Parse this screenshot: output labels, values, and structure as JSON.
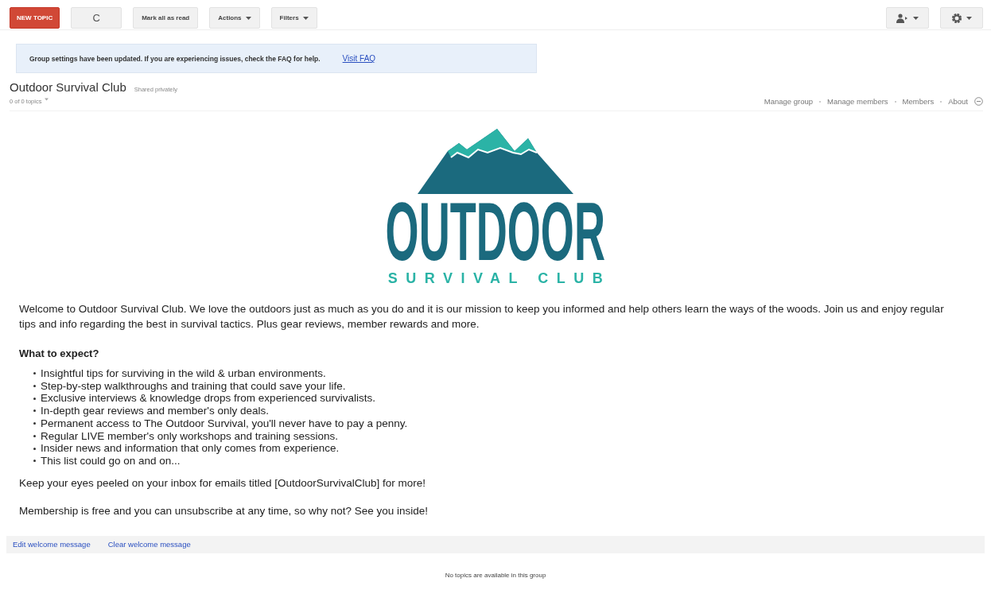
{
  "toolbar": {
    "new_topic": "NEW TOPIC",
    "refresh": "C",
    "mark_all_read": "Mark all as read",
    "actions": "Actions",
    "filters": "Filters"
  },
  "notice": {
    "text": "Group settings have been updated. If you are experiencing issues, check the FAQ for help.",
    "link": "Visit FAQ"
  },
  "group": {
    "title": "Outdoor Survival Club",
    "sharing": "Shared privately",
    "topic_count": "0 of 0 topics",
    "links": [
      "Manage group",
      "Manage members",
      "Members",
      "About"
    ]
  },
  "logo": {
    "word": "OUTDOOR",
    "tagline": "SURVIVAL CLUB"
  },
  "welcome": {
    "intro": "Welcome to Outdoor Survival Club. We love the outdoors just as much as you do and it is our mission to keep you informed and help others learn the ways of the woods. Join us and enjoy regular tips and info regarding the best in survival tactics. Plus gear reviews, member rewards and more.",
    "heading": "What to expect?",
    "items": [
      "Insightful tips for surviving in the wild & urban environments.",
      "Step-by-step walkthroughs and training that could save your life.",
      "Exclusive interviews & knowledge drops from experienced survivalists.",
      "In-depth gear reviews and member's only deals.",
      "Permanent access to The Outdoor Survival, you'll never have to pay a penny.",
      "Regular LIVE member's only workshops and training sessions.",
      "Insider news and information that only comes from experience.",
      "This list could go on and on..."
    ],
    "paragraphs": [
      "Keep your eyes peeled on your inbox for emails titled [OutdoorSurvivalClub] for more!",
      "Membership is free and you can unsubscribe at any time, so why not? See you inside!"
    ]
  },
  "welcome_actions": [
    "Edit welcome message",
    "Clear welcome message"
  ],
  "empty_message": "No topics are available in this group"
}
